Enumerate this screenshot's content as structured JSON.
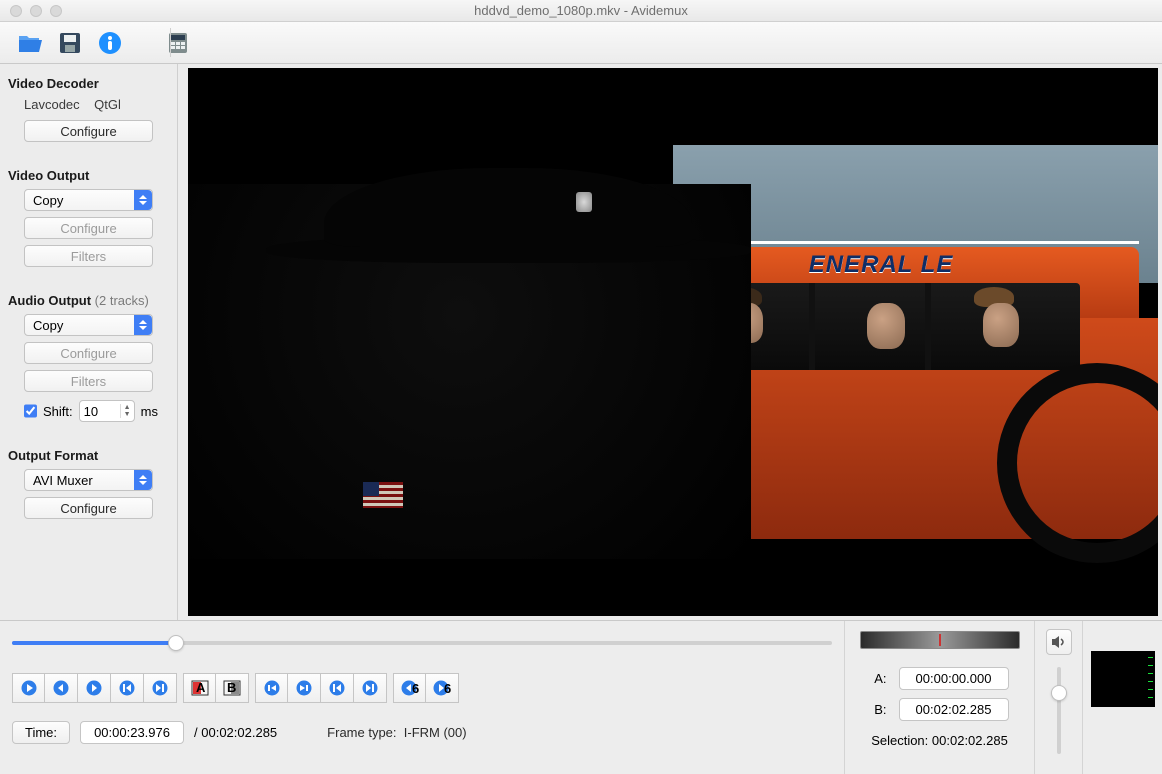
{
  "window": {
    "title": "hddvd_demo_1080p.mkv - Avidemux"
  },
  "toolbar": {
    "open": "open-icon",
    "save": "save-icon",
    "info": "info-icon",
    "calc": "calc-icon"
  },
  "sidebar": {
    "videoDecoder": {
      "title": "Video Decoder",
      "codec": "Lavcodec",
      "renderer": "QtGl",
      "configure": "Configure"
    },
    "videoOutput": {
      "title": "Video Output",
      "value": "Copy",
      "configure": "Configure",
      "filters": "Filters"
    },
    "audioOutput": {
      "title": "Audio Output",
      "tracks": "(2 tracks)",
      "value": "Copy",
      "configure": "Configure",
      "filters": "Filters",
      "shiftLabel": "Shift:",
      "shiftValue": "10",
      "shiftUnit": "ms",
      "shiftChecked": true
    },
    "outputFormat": {
      "title": "Output Format",
      "value": "AVI Muxer",
      "configure": "Configure"
    }
  },
  "preview": {
    "roofText": "ENERAL LE"
  },
  "timeline": {
    "positionPct": 20,
    "timeLabel": "Time:",
    "timeValue": "00:00:23.976",
    "duration": "/ 00:02:02.285",
    "frameTypeLabel": "Frame type:",
    "frameType": "I-FRM (00)"
  },
  "markers": {
    "aLabel": "A:",
    "a": "00:00:00.000",
    "bLabel": "B:",
    "b": "00:02:02.285",
    "selectionLabel": "Selection:",
    "selection": "00:02:02.285"
  },
  "volume": {
    "pct": 30
  }
}
